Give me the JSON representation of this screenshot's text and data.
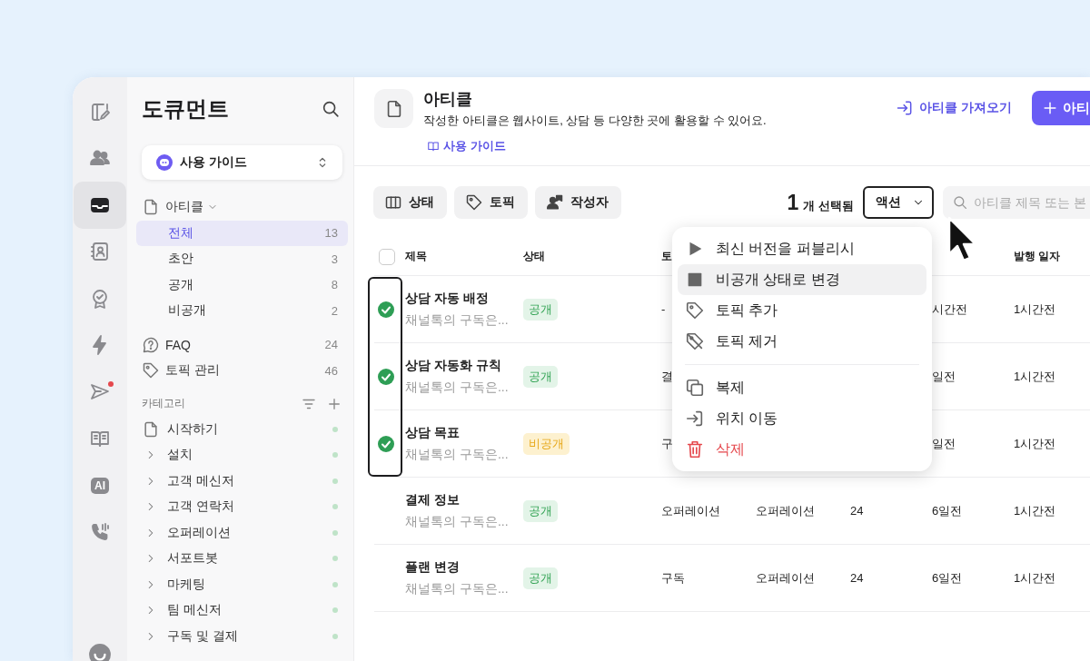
{
  "rail": {
    "items": [
      {
        "selected": false,
        "badge": false
      },
      {
        "selected": false,
        "badge": false
      },
      {
        "selected": true,
        "badge": false
      },
      {
        "selected": false,
        "badge": false
      },
      {
        "selected": false,
        "badge": false
      },
      {
        "selected": false,
        "badge": false
      },
      {
        "selected": false,
        "badge": true
      },
      {
        "selected": false,
        "badge": false
      },
      {
        "selected": false,
        "badge": false,
        "label": "AI"
      },
      {
        "selected": false,
        "badge": false
      }
    ]
  },
  "sidebar": {
    "title": "도큐먼트",
    "space_selector": {
      "label": "사용 가이드"
    },
    "nav": [
      {
        "label": "아티클",
        "expanded": true,
        "children": [
          {
            "label": "전체",
            "count": "13",
            "selected": true
          },
          {
            "label": "초안",
            "count": "3",
            "selected": false
          },
          {
            "label": "공개",
            "count": "8",
            "selected": false
          },
          {
            "label": "비공개",
            "count": "2",
            "selected": false
          }
        ]
      },
      {
        "label": "FAQ",
        "count": "24"
      },
      {
        "label": "토픽 관리",
        "count": "46"
      }
    ],
    "categories": {
      "title": "카테고리",
      "items": [
        {
          "label": "시작하기",
          "kind": "page"
        },
        {
          "label": "설치",
          "kind": "folder",
          "expanded": false
        },
        {
          "label": "고객 메신저",
          "kind": "folder",
          "expanded": false
        },
        {
          "label": "고객 연락처",
          "kind": "folder",
          "expanded": false
        },
        {
          "label": "오퍼레이션",
          "kind": "folder",
          "expanded": false
        },
        {
          "label": "서포트봇",
          "kind": "folder",
          "expanded": false
        },
        {
          "label": "마케팅",
          "kind": "folder",
          "expanded": false
        },
        {
          "label": "팀 메신저",
          "kind": "folder",
          "expanded": false
        },
        {
          "label": "구독 및 결제",
          "kind": "folder",
          "expanded": false
        }
      ]
    }
  },
  "header": {
    "title": "아티클",
    "description": "작성한 아티클은 웹사이트, 상담 등 다양한 곳에 활용할 수 있어요.",
    "guide_link": "사용 가이드",
    "import_button": "아티클 가져오기",
    "create_button": "아티"
  },
  "toolbar": {
    "filters": [
      "상태",
      "토픽",
      "작성자"
    ],
    "selection_count": "1",
    "selection_label": "개 선택됨",
    "action_button": "액션",
    "search": {
      "placeholder": "아티클 제목 또는 본"
    }
  },
  "table": {
    "header": {
      "checked": false,
      "title": "제목",
      "status": "상태",
      "column_3": "토",
      "published": "발행 일자"
    },
    "rows": [
      {
        "selected": true,
        "title": "상담 자동 배정",
        "excerpt": "채널톡의 구독은...",
        "status": {
          "label": "공개",
          "kind": "public"
        },
        "column_3": "-",
        "column_6": "시간전",
        "published": "1시간전"
      },
      {
        "selected": true,
        "title": "상담 자동화 규칙",
        "excerpt": "채널톡의 구독은...",
        "status": {
          "label": "공개",
          "kind": "public"
        },
        "column_3": "결",
        "column_6": "일전",
        "published": "1시간전"
      },
      {
        "selected": true,
        "title": "상담 목표",
        "excerpt": "채널톡의 구독은...",
        "status": {
          "label": "비공개",
          "kind": "private"
        },
        "column_3": "구",
        "column_6": "일전",
        "published": "1시간전"
      },
      {
        "selected": false,
        "title": "결제 정보",
        "excerpt": "채널톡의 구독은...",
        "status": {
          "label": "공개",
          "kind": "public"
        },
        "column_3": "오퍼레이션",
        "column_4": "오퍼레이션",
        "column_5": "24",
        "column_6": "6일전",
        "published": "1시간전"
      },
      {
        "selected": false,
        "title": "플랜 변경",
        "excerpt": "채널톡의 구독은...",
        "status": {
          "label": "공개",
          "kind": "public"
        },
        "column_3": "구독",
        "column_4": "오퍼레이션",
        "column_5": "24",
        "column_6": "6일전",
        "published": "1시간전"
      }
    ]
  },
  "action_menu": {
    "items": [
      {
        "kind": "action",
        "label": "최신 버전을 퍼블리시",
        "selected": false
      },
      {
        "kind": "action",
        "label": "비공개 상태로 변경",
        "selected": true
      },
      {
        "kind": "action",
        "label": "토픽 추가",
        "selected": false
      },
      {
        "kind": "action",
        "label": "토픽 제거",
        "selected": false
      },
      {
        "kind": "divider"
      },
      {
        "kind": "action",
        "label": "복제",
        "selected": false
      },
      {
        "kind": "action",
        "label": "위치 이동",
        "selected": false
      },
      {
        "kind": "danger",
        "label": "삭제",
        "selected": false
      }
    ]
  }
}
